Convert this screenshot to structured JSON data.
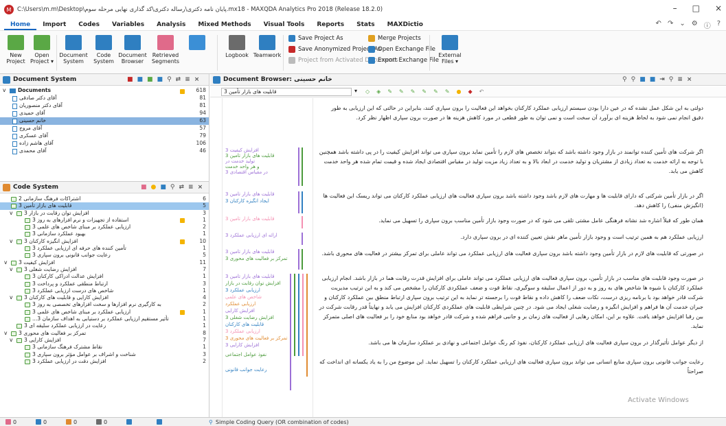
{
  "window": {
    "title": "C:\\Users\\m.m\\Desktop\\پایان نامه دکتری\\رساله دکتری\\کد گذاری نهایی مرحله سوم.mx18 - MAXQDA Analytics Pro 2018 (Release 18.2.0)",
    "minimize": "–",
    "maximize": "□",
    "close": "×"
  },
  "menu": [
    "Home",
    "Import",
    "Codes",
    "Variables",
    "Analysis",
    "Mixed Methods",
    "Visual Tools",
    "Reports",
    "Stats",
    "MAXDictio"
  ],
  "menu_tools": [
    "↶",
    "↷",
    "⌄",
    "⚙",
    "ⓘ",
    "?"
  ],
  "ribbon": {
    "big": [
      {
        "label": "New Project",
        "color": "#5aa845"
      },
      {
        "label": "Open Project ▾",
        "color": "#5aa845"
      },
      {
        "label": "Document System",
        "color": "#2f7fc1"
      },
      {
        "label": "Code System",
        "color": "#2f7fc1"
      },
      {
        "label": "Document Browser",
        "color": "#2f7fc1"
      },
      {
        "label": "Retrieved Segments",
        "color": "#e06a8a"
      },
      {
        "label": "",
        "color": "#3b8fd6"
      },
      {
        "label": "Logbook",
        "color": "#6b6b6b"
      },
      {
        "label": "Teamwork",
        "color": "#2f7fc1"
      },
      {
        "label": "External Files ▾",
        "color": "#2f7fc1"
      }
    ],
    "small": [
      {
        "label": "Save Project As",
        "color": "#2f7fc1"
      },
      {
        "label": "Save Anonymized Project As",
        "color": "#c62828"
      },
      {
        "label": "Project from Activated Documents",
        "color": "#bbbbbb"
      },
      {
        "label": "Merge Projects",
        "color": "#e0a020"
      },
      {
        "label": "Open Exchange File",
        "color": "#2f7fc1"
      },
      {
        "label": "Export Exchange File",
        "color": "#2f7fc1"
      }
    ]
  },
  "document_system": {
    "title": "Document System",
    "root": {
      "label": "Documents",
      "count": "618"
    },
    "items": [
      {
        "label": "آقای دکتر صادقی",
        "count": "81"
      },
      {
        "label": "آقای دکتر منصوریان",
        "count": "81"
      },
      {
        "label": "آقای حمیدی",
        "count": "94"
      },
      {
        "label": "خانم حسینی",
        "count": "63"
      },
      {
        "label": "آقای مروج",
        "count": "57"
      },
      {
        "label": "آقای عسکری",
        "count": "79"
      },
      {
        "label": "آقای هاشم زاده",
        "count": "106"
      },
      {
        "label": "آقای محمدی",
        "count": "46"
      }
    ]
  },
  "code_system": {
    "title": "Code System",
    "items": [
      {
        "label": "اشتراکات فرهنگ سازمانی 2",
        "count": "6"
      },
      {
        "label": "قابلیت های بازار تأمین 3",
        "count": "5"
      },
      {
        "label": "افزایش توان رقابت در بازار 3",
        "count": "3"
      },
      {
        "label": "استفاده از تجهیزات و نرم افزارهای به روز 3",
        "count": "1"
      },
      {
        "label": "ارزیابی عملکرد بر مبنای شاخص های علمی 3",
        "count": "2"
      },
      {
        "label": "بهبود عملکرد سازمانی 3",
        "count": "1"
      },
      {
        "label": "افزایش انگیزه کارکنان 3",
        "count": "10"
      },
      {
        "label": "تأمین کننده های حرفه ای ارزیابی عملکرد 3",
        "count": "1"
      },
      {
        "label": "رعایت جوانب قانونی برون سپاری 3",
        "count": "5"
      },
      {
        "label": "افزایش کیفیت 3",
        "count": "11"
      },
      {
        "label": "افزایش رضایت شغلی 3",
        "count": "7"
      },
      {
        "label": "افزایش عدالت ادراکی کارکنان 3",
        "count": "1"
      },
      {
        "label": "ارتباط منطقی عملکرد و پرداخت 3",
        "count": "3"
      },
      {
        "label": "شاخص های درست ارزیابی عملکرد 3",
        "count": "1"
      },
      {
        "label": "افزایش کارایی و قابلیت های کارکنان 3",
        "count": "4"
      },
      {
        "label": "به کارگیری نرم افزارها و سخت افزارهای تخصصی به روز 3",
        "count": "2"
      },
      {
        "label": "ارزیابی عملکرد بر مبنای شاخص های علمی 3",
        "count": "1"
      },
      {
        "label": "تأثیر مستقیم ارزیابی عملکرد بر دستیابی به اهداف سازمان 3...",
        "count": "1"
      },
      {
        "label": "رعایت در ارزیابی عملکرد سلیقه ای 3",
        "count": "1"
      },
      {
        "label": "تمرکز بر فعالیت های محوری 3",
        "count": "8"
      },
      {
        "label": "افزایش کارایی 3",
        "count": "7"
      },
      {
        "label": "نقاط مشترک فرهنگ سازمانی 3",
        "count": "1"
      },
      {
        "label": "شناخت و اشراف بر عوامل مؤثر برون سپاری 3",
        "count": "3"
      },
      {
        "label": "افزایش دقت در ارزیابی عملکرد 3",
        "count": "2"
      }
    ]
  },
  "document_browser": {
    "title": "Document Browser: خانم حسینی",
    "code_combo": "قابلیت های بازار تأمین 3",
    "paragraphs": [
      {
        "num": "",
        "text": "دولتی به این شکل عمل نشده که در عین دارا بودن سیستم ارزیابی عملکرد کارکنان بخواهد این فعالیت را برون سپاری کنند، بنابراین در حالتی که این ارزیابی به طور دقیق انجام نمی شود به لحاظ هزینه ای برآورد آن سخت است و نمی توان به طور قطعی در مورد کاهش هزینه ها در صورت برون سپاری اظهار نظر کرد."
      },
      {
        "num": "31",
        "text": "اگر شرکت های تأمین کننده توانمند در بازار وجود داشته باشد که بتواند تخصص های لازم را تأمین نماید برون سپاری می تواند افزایش کیفیت را در پی داشته باشد همچنین با توجه به ارائه خدمت به تعداد زیادی از مشتریان و تولید خدمت در ابعاد بالا و به تعداد زیاد مزیت تولید در مقیاس اقتصادی ایجاد شده و قیمت تمام شده هر واحد خدمت کاهش می یابد."
      },
      {
        "num": "32",
        "text": "اگر در بازار تأمین شرکتی که دارای قابلیت ها و مهارت های لازم باشد وجود داشته باشد برون سپاری فعالیت های ارزیابی عملکرد کارکنان می تواند ریسک این فعالیت ها (انگیزش منفی) را کاهش دهد."
      },
      {
        "num": "33",
        "text": "همان طور که قبلاً اشاره شد نشانه فرهنگی عامل مشتی تلقی می شود که در صورت وجود بازار تأمین مناسب برون سپاری را تسهیل می نماید."
      },
      {
        "num": "34",
        "text": "ارزیابی عملکرد هم به همین ترتیب است و وجود بازار تأمین ماهر نقش تعیین کننده ای در برون سپاری دارد."
      },
      {
        "num": "35",
        "text": "در صورتی که قابلیت های لازم در بازار تأمین وجود داشته باشد برون سپاری فعالیت های ارزیابی عملکرد می تواند عاملی برای تمرکز بیشتر در فعالیت های محوری باشد."
      },
      {
        "num": "36",
        "text": "در صورت وجود قابلیت های مناسب در بازار تأمین، برون سپاری فعالیت های ارزیابی عملکرد می تواند عاملی برای افزایش قدرت رقابت هما در بازار باشد. انجام ارزیابی عملکرد کارکنان با شیوه ها شاخص های به روز و به دور از اعمال سلیقه و سوگیری، نقاط قوت و ضعف عملکردی کارکنان را مشخص می کند و به این ترتیب مدیریت شرکت قادر خواهد بود با برنامه ریزی درست، نکات ضعف را کاهش داده و نقاط قوت را برجسته تر نماید به این ترتیب برون سپاری ارتباط منطق بین عملکرد کارکنان و جبران خدمت آن ها فراهم و افزایش انگیزه و رضایت شغلی ایجاد می شود. در چنین شرایطی قابلیت های عملکردی کارکنان افزایش می یابد و نهایتاً قدر رقابت شرکت در بین رقبا افزایش خواهد یافت. علاوه بر این، امکان رهایی از فعالیت های زمان بر و جانبی فراهم شده و شرکت قادر خواهد بود منابع خود را بر فعالیت های اصلی متمرکز نماید."
      },
      {
        "num": "37",
        "text": "از دیگر عوامل تأثیرگذار در برون سپاری فعالیت های ارزیابی عملکرد کارکنان، نفوذ کم رنگ عوامل اجتماعی و نهادی بر عملکرد سازمان ها می باشد."
      },
      {
        "num": "38",
        "text": "رعایت جوانب قانونی برون سپاری منابع انسانی می تواند برون سپاری فعالیت های ارزیابی عملکرد کارکنان را تسهیل نماید. این موضوع من را به یاد یکسانه ای انداخت که صراحتاً"
      }
    ],
    "coding_labels": [
      "افزایش کیفیت 3",
      "قابلیت های بازار تأمین 3",
      "تولید خدمت در",
      "و هر واحد خدمت",
      "در مقیاس اقتصادی 3",
      "قابلیت های بازار تأمین 3",
      "ایجاد انگیزه کارکنان 3",
      "قابلیت های بازار تأمین 3",
      "ارائه ای ارزیابی عملکرد 3",
      "قابلیت های بازار تأمین 3",
      "تمرکز بر فعالیت های محوری 3",
      "قابلیت های بازار تأمین 3",
      "افزایش توان رقابت در بازار",
      "ارزیابی عملکرد 3",
      "شاخص های علمی",
      "ارزیابی عملکرد",
      "افزایش کارایی",
      "افزایش رضایت شغلی 3",
      "قابلیت های کارکنان",
      "ارزیابی عملکرد 3",
      "تمرکز بر فعالیت های محوری 3",
      "افزایش کارایی 3",
      "نفوذ عوامل اجتماعی",
      "رعایت جوانب قانونی"
    ],
    "watermark": "Activate Windows"
  },
  "status": [
    {
      "value": "0",
      "color": "#e06a8a"
    },
    {
      "value": "0",
      "color": "#2f7fc1"
    },
    {
      "value": "0",
      "color": "#e08a30"
    },
    {
      "value": "0",
      "color": "#6b6b6b"
    },
    {
      "value": "",
      "color": "#2f7fc1"
    },
    {
      "value": "",
      "color": "#2f7fc1"
    }
  ],
  "status_query": "Simple Coding Query (OR combination of codes)"
}
